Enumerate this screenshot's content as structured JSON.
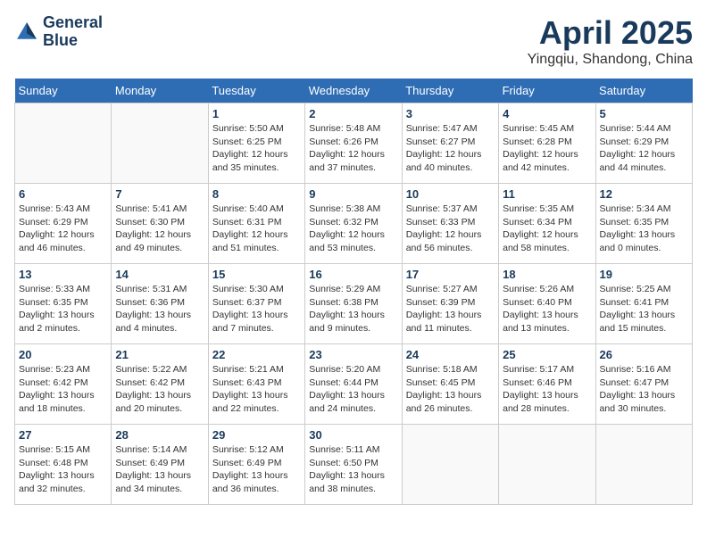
{
  "logo": {
    "line1": "General",
    "line2": "Blue"
  },
  "title": "April 2025",
  "location": "Yingqiu, Shandong, China",
  "days_header": [
    "Sunday",
    "Monday",
    "Tuesday",
    "Wednesday",
    "Thursday",
    "Friday",
    "Saturday"
  ],
  "weeks": [
    [
      {
        "num": "",
        "info": ""
      },
      {
        "num": "",
        "info": ""
      },
      {
        "num": "1",
        "info": "Sunrise: 5:50 AM\nSunset: 6:25 PM\nDaylight: 12 hours and 35 minutes."
      },
      {
        "num": "2",
        "info": "Sunrise: 5:48 AM\nSunset: 6:26 PM\nDaylight: 12 hours and 37 minutes."
      },
      {
        "num": "3",
        "info": "Sunrise: 5:47 AM\nSunset: 6:27 PM\nDaylight: 12 hours and 40 minutes."
      },
      {
        "num": "4",
        "info": "Sunrise: 5:45 AM\nSunset: 6:28 PM\nDaylight: 12 hours and 42 minutes."
      },
      {
        "num": "5",
        "info": "Sunrise: 5:44 AM\nSunset: 6:29 PM\nDaylight: 12 hours and 44 minutes."
      }
    ],
    [
      {
        "num": "6",
        "info": "Sunrise: 5:43 AM\nSunset: 6:29 PM\nDaylight: 12 hours and 46 minutes."
      },
      {
        "num": "7",
        "info": "Sunrise: 5:41 AM\nSunset: 6:30 PM\nDaylight: 12 hours and 49 minutes."
      },
      {
        "num": "8",
        "info": "Sunrise: 5:40 AM\nSunset: 6:31 PM\nDaylight: 12 hours and 51 minutes."
      },
      {
        "num": "9",
        "info": "Sunrise: 5:38 AM\nSunset: 6:32 PM\nDaylight: 12 hours and 53 minutes."
      },
      {
        "num": "10",
        "info": "Sunrise: 5:37 AM\nSunset: 6:33 PM\nDaylight: 12 hours and 56 minutes."
      },
      {
        "num": "11",
        "info": "Sunrise: 5:35 AM\nSunset: 6:34 PM\nDaylight: 12 hours and 58 minutes."
      },
      {
        "num": "12",
        "info": "Sunrise: 5:34 AM\nSunset: 6:35 PM\nDaylight: 13 hours and 0 minutes."
      }
    ],
    [
      {
        "num": "13",
        "info": "Sunrise: 5:33 AM\nSunset: 6:35 PM\nDaylight: 13 hours and 2 minutes."
      },
      {
        "num": "14",
        "info": "Sunrise: 5:31 AM\nSunset: 6:36 PM\nDaylight: 13 hours and 4 minutes."
      },
      {
        "num": "15",
        "info": "Sunrise: 5:30 AM\nSunset: 6:37 PM\nDaylight: 13 hours and 7 minutes."
      },
      {
        "num": "16",
        "info": "Sunrise: 5:29 AM\nSunset: 6:38 PM\nDaylight: 13 hours and 9 minutes."
      },
      {
        "num": "17",
        "info": "Sunrise: 5:27 AM\nSunset: 6:39 PM\nDaylight: 13 hours and 11 minutes."
      },
      {
        "num": "18",
        "info": "Sunrise: 5:26 AM\nSunset: 6:40 PM\nDaylight: 13 hours and 13 minutes."
      },
      {
        "num": "19",
        "info": "Sunrise: 5:25 AM\nSunset: 6:41 PM\nDaylight: 13 hours and 15 minutes."
      }
    ],
    [
      {
        "num": "20",
        "info": "Sunrise: 5:23 AM\nSunset: 6:42 PM\nDaylight: 13 hours and 18 minutes."
      },
      {
        "num": "21",
        "info": "Sunrise: 5:22 AM\nSunset: 6:42 PM\nDaylight: 13 hours and 20 minutes."
      },
      {
        "num": "22",
        "info": "Sunrise: 5:21 AM\nSunset: 6:43 PM\nDaylight: 13 hours and 22 minutes."
      },
      {
        "num": "23",
        "info": "Sunrise: 5:20 AM\nSunset: 6:44 PM\nDaylight: 13 hours and 24 minutes."
      },
      {
        "num": "24",
        "info": "Sunrise: 5:18 AM\nSunset: 6:45 PM\nDaylight: 13 hours and 26 minutes."
      },
      {
        "num": "25",
        "info": "Sunrise: 5:17 AM\nSunset: 6:46 PM\nDaylight: 13 hours and 28 minutes."
      },
      {
        "num": "26",
        "info": "Sunrise: 5:16 AM\nSunset: 6:47 PM\nDaylight: 13 hours and 30 minutes."
      }
    ],
    [
      {
        "num": "27",
        "info": "Sunrise: 5:15 AM\nSunset: 6:48 PM\nDaylight: 13 hours and 32 minutes."
      },
      {
        "num": "28",
        "info": "Sunrise: 5:14 AM\nSunset: 6:49 PM\nDaylight: 13 hours and 34 minutes."
      },
      {
        "num": "29",
        "info": "Sunrise: 5:12 AM\nSunset: 6:49 PM\nDaylight: 13 hours and 36 minutes."
      },
      {
        "num": "30",
        "info": "Sunrise: 5:11 AM\nSunset: 6:50 PM\nDaylight: 13 hours and 38 minutes."
      },
      {
        "num": "",
        "info": ""
      },
      {
        "num": "",
        "info": ""
      },
      {
        "num": "",
        "info": ""
      }
    ]
  ]
}
